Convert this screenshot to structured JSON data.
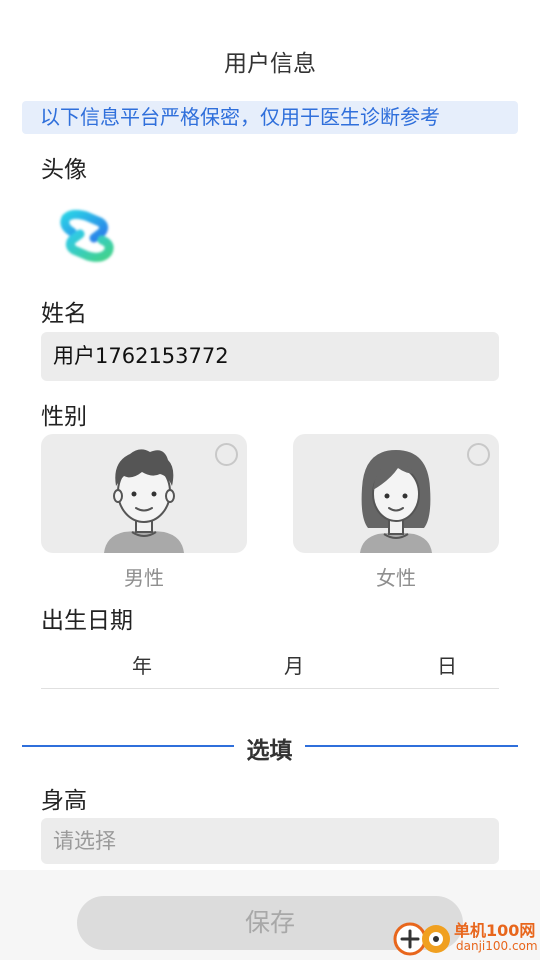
{
  "header": {
    "title": "用户信息"
  },
  "notice": {
    "text": "以下信息平台严格保密，仅用于医生诊断参考",
    "color": "#2f6fdb",
    "background": "#e6eefb"
  },
  "avatar": {
    "label": "头像",
    "icon": "app-logo-icon"
  },
  "name": {
    "label": "姓名",
    "value": "用户1762153772"
  },
  "gender": {
    "label": "性别",
    "options": [
      {
        "label": "男性",
        "icon": "male-avatar-icon",
        "selected": false
      },
      {
        "label": "女性",
        "icon": "female-avatar-icon",
        "selected": false
      }
    ]
  },
  "birth": {
    "label": "出生日期",
    "year": "年",
    "month": "月",
    "day": "日"
  },
  "optional_section": {
    "label": "选填",
    "divider_color": "#2f6fdb"
  },
  "height": {
    "label": "身高",
    "placeholder": "请选择"
  },
  "footer": {
    "save_label": "保存"
  },
  "watermark": {
    "text_cn": "单机100网",
    "text_en": "danji100.com",
    "color": "#e8661c"
  }
}
